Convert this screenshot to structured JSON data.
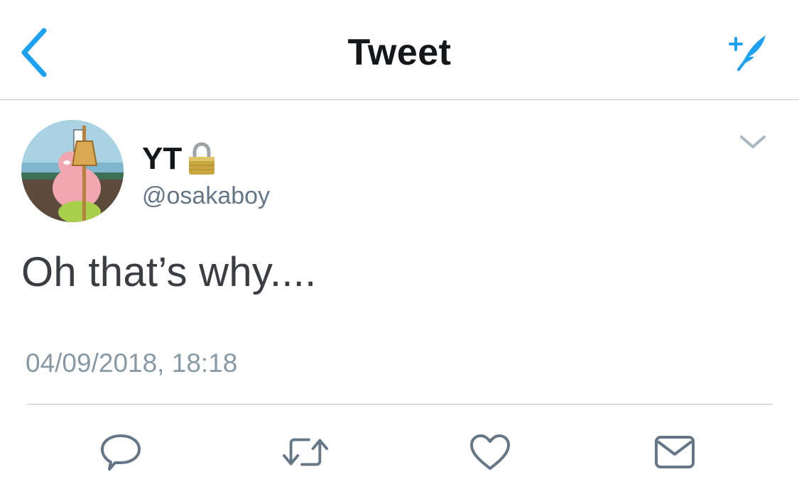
{
  "nav": {
    "title": "Tweet",
    "back_icon": "chevron-left-icon",
    "compose_icon": "compose-tweet-icon"
  },
  "tweet": {
    "display_name": "YT",
    "protected_icon": "lock-icon",
    "handle": "@osakaboy",
    "text": "Oh that’s why....",
    "timestamp": "04/09/2018, 18:18",
    "more_icon": "chevron-down-icon"
  },
  "actions": [
    {
      "name": "reply",
      "icon": "reply-icon"
    },
    {
      "name": "retweet",
      "icon": "retweet-icon"
    },
    {
      "name": "like",
      "icon": "heart-icon"
    },
    {
      "name": "share",
      "icon": "envelope-icon"
    }
  ],
  "colors": {
    "accent": "#1da1f2",
    "text_primary": "#14171a",
    "text_secondary": "#657786",
    "timestamp": "#8899a6",
    "icon": "#657786"
  }
}
